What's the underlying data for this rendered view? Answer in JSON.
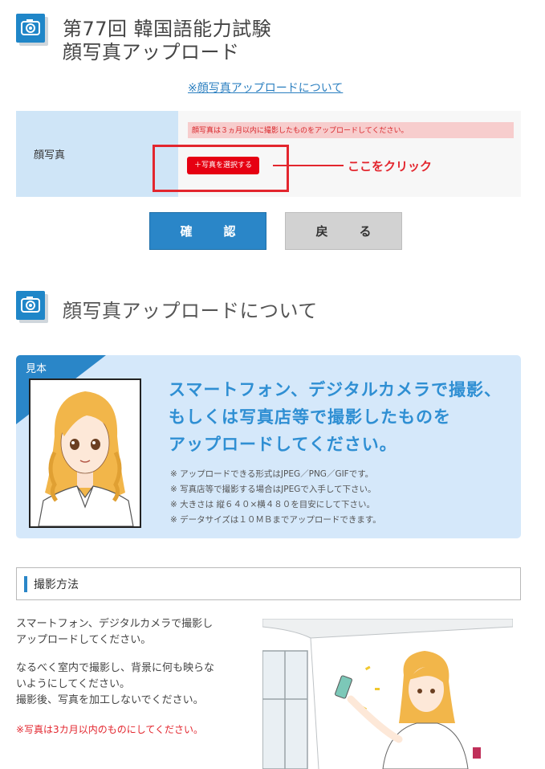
{
  "header": {
    "title_line1": "第77回 韓国語能力試験",
    "title_line2": "顔写真アップロード",
    "about_link": "※顔写真アップロードについて"
  },
  "form": {
    "label": "顔写真",
    "note": "顔写真は３ヵ月以内に撮影したものをアップロードしてください。",
    "select_button": "＋写真を選択する",
    "callout": "ここをクリック"
  },
  "buttons": {
    "confirm": "確　認",
    "back": "戻　る"
  },
  "about_section": {
    "title": "顔写真アップロードについて"
  },
  "sample": {
    "ribbon": "見本",
    "headline": [
      "スマートフォン、デジタルカメラで撮影、",
      "もしくは写真店等で撮影したものを",
      "アップロードしてください。"
    ],
    "notes": [
      "※ アップロードできる形式はJPEG／PNG／GIFです。",
      "※ 写真店等で撮影する場合はJPEGで入手して下さい。",
      "※ 大きさは 縦６４０×横４８０を目安にして下さい。",
      "※ データサイズは１０ＭＢまでアップロードできます。"
    ]
  },
  "shooting": {
    "title": "撮影方法",
    "para1": [
      "スマートフォン、デジタルカメラで撮影し",
      "アップロードしてください。"
    ],
    "para2": [
      "なるべく室内で撮影し、背景に何も映らな",
      "いようにしてください。",
      "撮影後、写真を加工しないでください。"
    ],
    "red_note": "※写真は3カ月以内のものにしてください。"
  },
  "icons": {
    "section_icon": "camera-icon"
  },
  "colors": {
    "accent_blue": "#2a86c8",
    "alert_red": "#e3262e",
    "label_bg": "#cfe5f7",
    "panel_bg": "#d5e8fa"
  }
}
